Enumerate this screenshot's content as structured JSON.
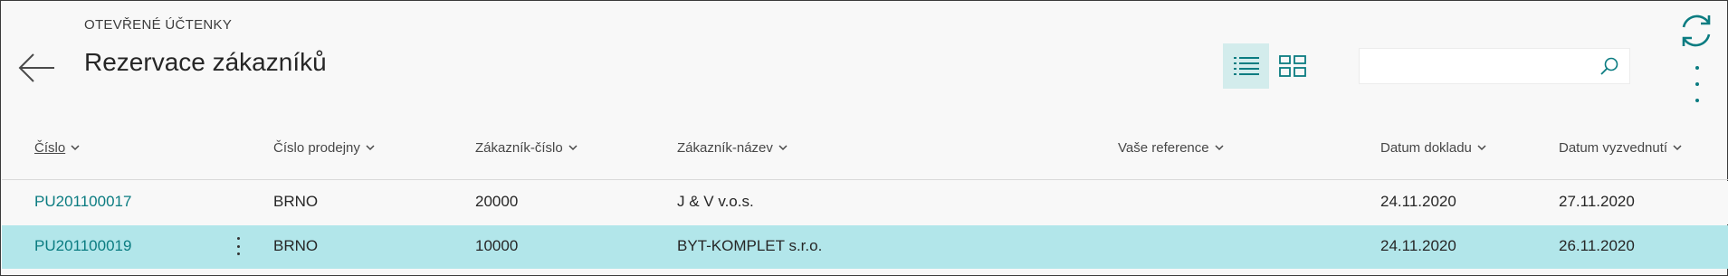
{
  "header": {
    "caption": "OTEVŘENÉ ÚČTENKY",
    "title": "Rezervace zákazníků"
  },
  "search": {
    "value": "",
    "placeholder": ""
  },
  "icons": {
    "back": "arrow-left-icon",
    "list_view": "list-view-icon",
    "tile_view": "tile-view-icon",
    "search": "search-icon",
    "refresh": "refresh-icon",
    "more": "more-vertical-icon"
  },
  "colors": {
    "accent": "#0b7c81",
    "selected_row": "#b2e6ea",
    "active_view": "#d3ecec",
    "background": "#f8f8f8"
  },
  "table": {
    "columns": [
      "Číslo",
      "Číslo prodejny",
      "Zákazník-číslo",
      "Zákazník-název",
      "Vaše reference",
      "Datum dokladu",
      "Datum vyzvednutí"
    ],
    "rows": [
      [
        "PU201100017",
        "BRNO",
        "20000",
        "J & V v.o.s.",
        "",
        "24.11.2020",
        "27.11.2020"
      ],
      [
        "PU201100019",
        "BRNO",
        "10000",
        "BYT-KOMPLET s.r.o.",
        "",
        "24.11.2020",
        "26.11.2020"
      ]
    ],
    "selected_row_index": 1
  }
}
